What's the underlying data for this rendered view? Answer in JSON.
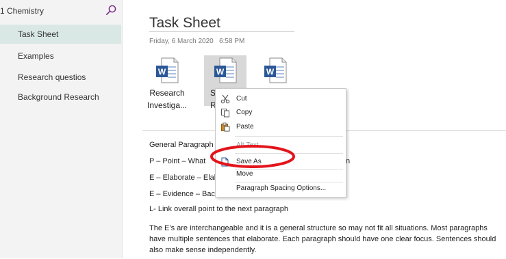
{
  "sidebar": {
    "notebook_title": "1 Chemistry",
    "items": [
      {
        "label": "Task Sheet"
      },
      {
        "label": "Examples"
      },
      {
        "label": "Research questios"
      },
      {
        "label": "Background Research"
      }
    ]
  },
  "page": {
    "title": "Task Sheet",
    "date": "Friday, 6 March 2020",
    "time": "6:58 PM",
    "files": [
      {
        "line1": "Research",
        "line2": "Investiga..."
      },
      {
        "line1": "S",
        "line2": "Re"
      },
      {
        "line1": "",
        "line2": ""
      }
    ],
    "lines": [
      "General Paragraph",
      "P – Point – What",
      "E – Elaborate – Elab",
      "E – Evidence – Back",
      "L- Link overall point to the next paragraph"
    ],
    "line_tail": "n",
    "paragraph": "The E’s are interchangeable and it is a general structure so may not fit all situations. Most paragraphs have multiple sentences that elaborate. Each paragraph should have one clear focus. Sentences should also make sense independently."
  },
  "context_menu": {
    "cut": "Cut",
    "copy": "Copy",
    "paste": "Paste",
    "alt_text": "Alt Text...",
    "save_as": "Save As",
    "move": "Move",
    "paragraph_spacing": "Paragraph Spacing Options..."
  },
  "colors": {
    "sidebar_selected": "#d9e8e4",
    "search_icon": "#7a2a8a",
    "word_blue": "#2b5797",
    "annotation_red": "#e3141b"
  }
}
